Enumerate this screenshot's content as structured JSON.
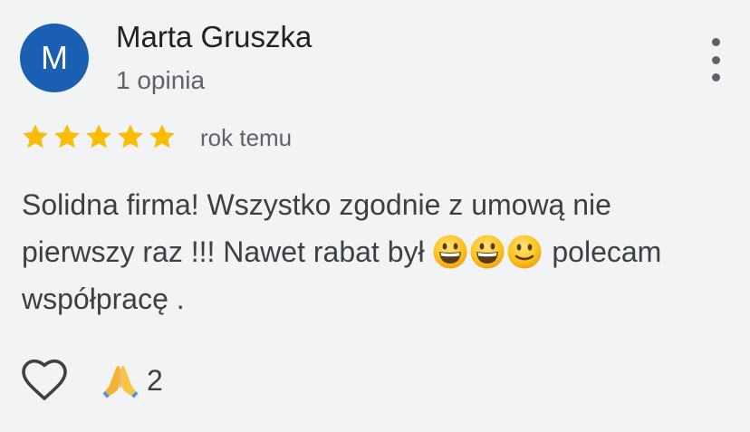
{
  "review": {
    "author": {
      "initial": "M",
      "name": "Marta Gruszka",
      "review_count": "1 opinia",
      "avatar_color": "#1a5fb4"
    },
    "rating": 5,
    "rating_max": 5,
    "star_color": "#fbbc04",
    "time": "rok temu",
    "text": {
      "line1": "Solidna firma! Wszystko zgodnie z umową nie",
      "line2_before": "pierwszy raz !!! Nawet rabat był ",
      "line2_after": " polecam",
      "line3": "współpracę .",
      "emojis": [
        "grinning-face-emoji",
        "grinning-face-emoji",
        "slightly-smiling-face-emoji"
      ]
    },
    "actions": {
      "like_icon": "heart-outline-icon",
      "reaction_icon": "folded-hands-emoji",
      "reaction_count": "2"
    },
    "menu_icon": "more-vertical-icon"
  }
}
